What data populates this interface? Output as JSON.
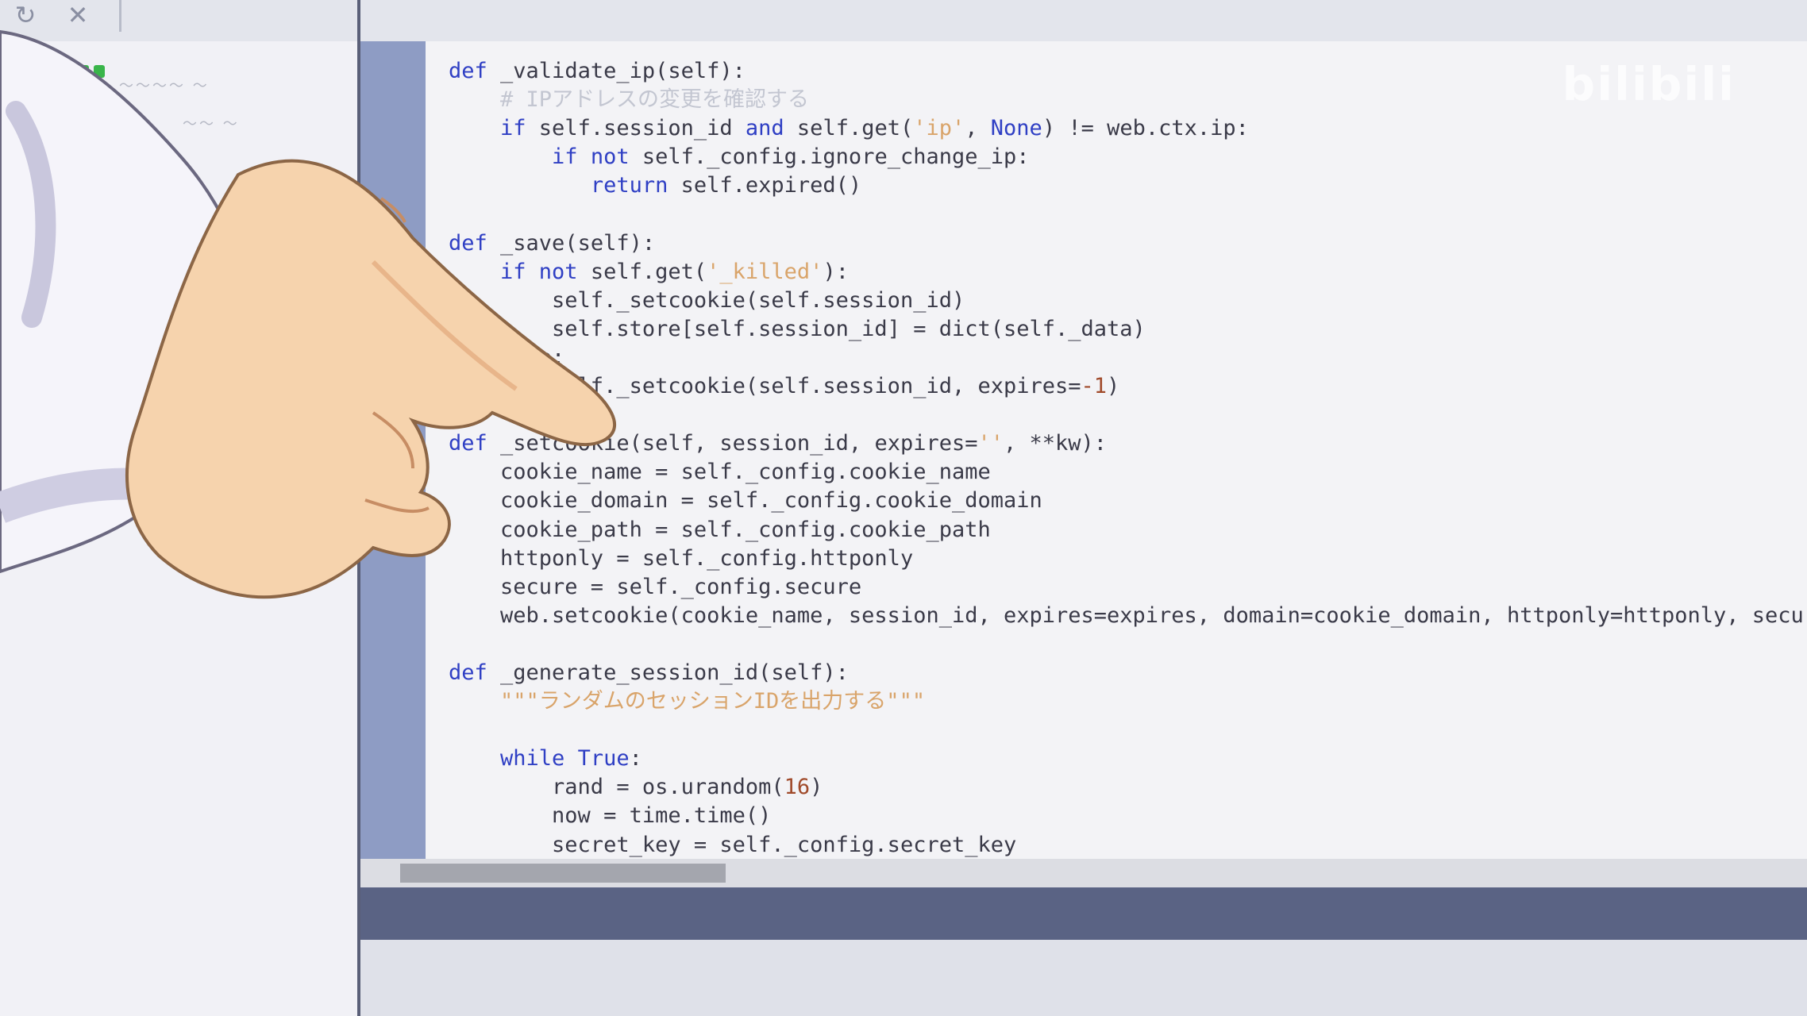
{
  "toolbar": {
    "refresh_icon": "refresh-icon",
    "close_icon": "close-icon"
  },
  "sidebar": {
    "items": [
      {
        "icon": "grid-icon"
      },
      {
        "icon": "none"
      }
    ]
  },
  "editor": {
    "watermark": "bilibili",
    "lines": [
      [
        [
          "kw",
          "def"
        ],
        [
          "t",
          " _validate_ip(self):"
        ]
      ],
      [
        [
          "t",
          "    "
        ],
        [
          "cmt",
          "# IPアドレスの変更を確認する"
        ]
      ],
      [
        [
          "t",
          "    "
        ],
        [
          "kw",
          "if"
        ],
        [
          "t",
          " self.session_id "
        ],
        [
          "kw",
          "and"
        ],
        [
          "t",
          " self.get("
        ],
        [
          "str",
          "'ip'"
        ],
        [
          "t",
          ", "
        ],
        [
          "kw",
          "None"
        ],
        [
          "t",
          ") != web.ctx.ip:"
        ]
      ],
      [
        [
          "t",
          "        "
        ],
        [
          "kw",
          "if not"
        ],
        [
          "t",
          " self._config.ignore_change_ip:"
        ]
      ],
      [
        [
          "t",
          "           "
        ],
        [
          "kw",
          "return"
        ],
        [
          "t",
          " self.expired()"
        ]
      ],
      [
        [
          "t",
          ""
        ]
      ],
      [
        [
          "kw",
          "def"
        ],
        [
          "t",
          " _save(self):"
        ]
      ],
      [
        [
          "t",
          "    "
        ],
        [
          "kw",
          "if not"
        ],
        [
          "t",
          " self.get("
        ],
        [
          "str",
          "'_killed'"
        ],
        [
          "t",
          "):"
        ]
      ],
      [
        [
          "t",
          "        self._setcookie(self.session_id)"
        ]
      ],
      [
        [
          "t",
          "        self.store[self.session_id] = dict(self._data)"
        ]
      ],
      [
        [
          "t",
          "    else:"
        ]
      ],
      [
        [
          "t",
          "        self._setcookie(self.session_id, expires="
        ],
        [
          "num",
          "-1"
        ],
        [
          "t",
          ")"
        ]
      ],
      [
        [
          "t",
          ""
        ]
      ],
      [
        [
          "kw",
          "def"
        ],
        [
          "t",
          " _setcookie(self, session_id, expires="
        ],
        [
          "str",
          "''"
        ],
        [
          "t",
          ", **kw):"
        ]
      ],
      [
        [
          "t",
          "    cookie_name = self._config.cookie_name"
        ]
      ],
      [
        [
          "t",
          "    cookie_domain = self._config.cookie_domain"
        ]
      ],
      [
        [
          "t",
          "    cookie_path = self._config.cookie_path"
        ]
      ],
      [
        [
          "t",
          "    httponly = self._config.httponly"
        ]
      ],
      [
        [
          "t",
          "    secure = self._config.secure"
        ]
      ],
      [
        [
          "t",
          "    web.setcookie(cookie_name, session_id, expires=expires, domain=cookie_domain, httponly=httponly, secure=secure"
        ]
      ],
      [
        [
          "t",
          ""
        ]
      ],
      [
        [
          "kw",
          "def"
        ],
        [
          "t",
          " _generate_session_id(self):"
        ]
      ],
      [
        [
          "t",
          "    "
        ],
        [
          "str",
          "\"\"\"ランダムのセッションIDを出力する\"\"\""
        ]
      ],
      [
        [
          "t",
          ""
        ]
      ],
      [
        [
          "t",
          "    "
        ],
        [
          "kw",
          "while True"
        ],
        [
          "t",
          ":"
        ]
      ],
      [
        [
          "t",
          "        rand = os.urandom("
        ],
        [
          "num",
          "16"
        ],
        [
          "t",
          ")"
        ]
      ],
      [
        [
          "t",
          "        now = time.time()"
        ]
      ],
      [
        [
          "t",
          "        secret_key = self._config.secret_key"
        ]
      ]
    ]
  },
  "colors": {
    "keyword": "#2f3fc4",
    "string": "#d9a46a",
    "number": "#a04a2a",
    "comment": "#c3c6d1",
    "gutter": "#8e9cc4"
  }
}
